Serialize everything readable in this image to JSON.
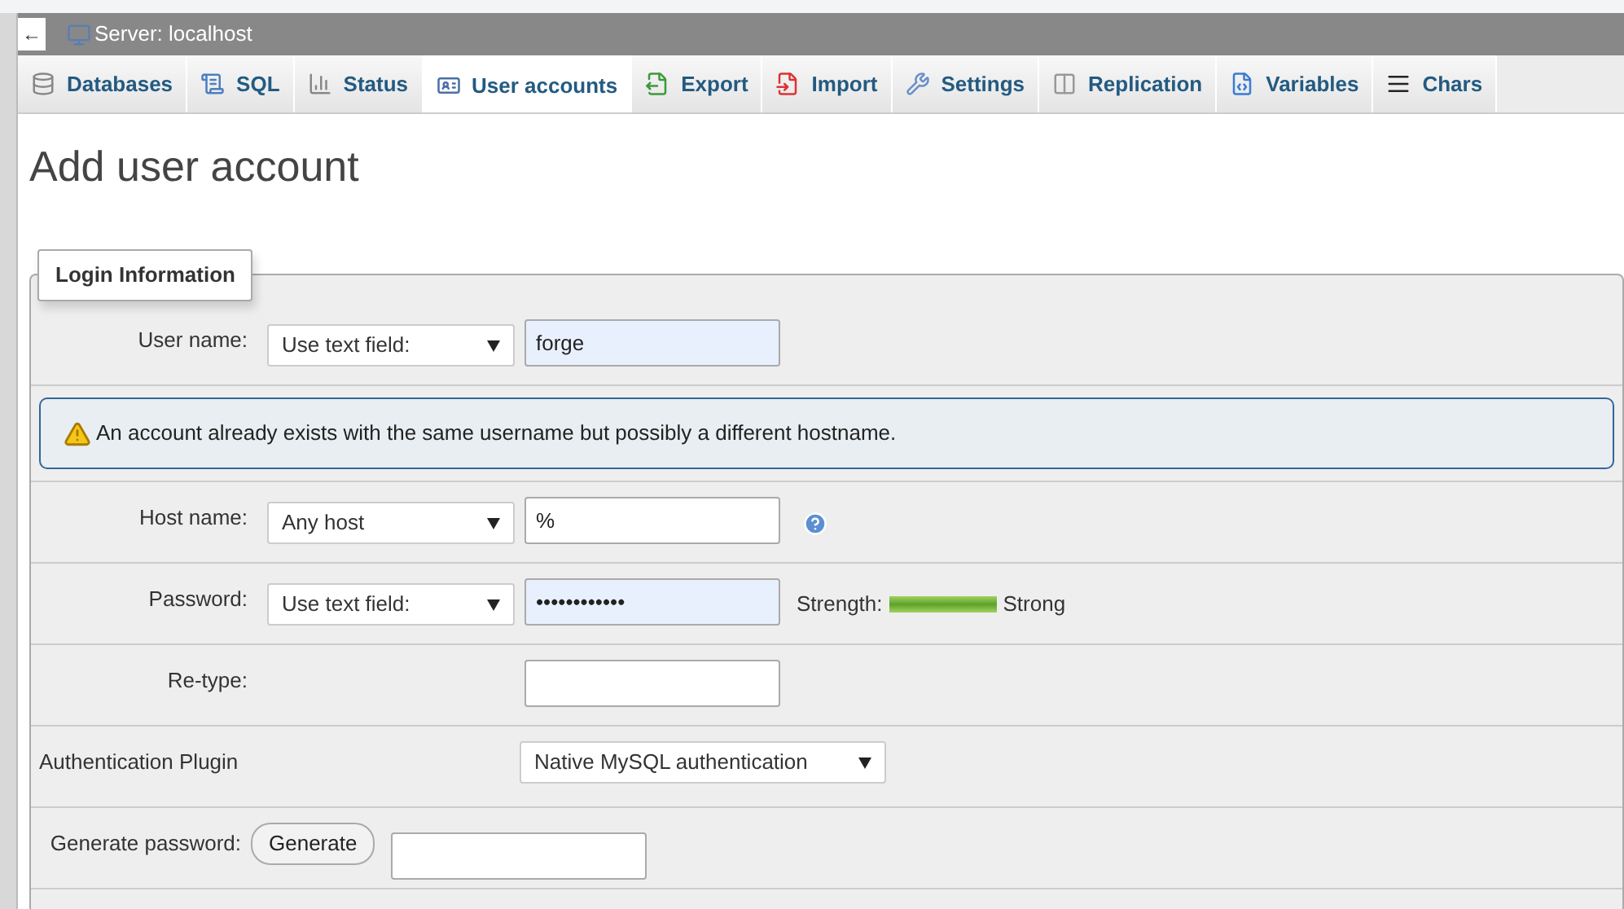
{
  "header": {
    "back": "←",
    "title": "Server: localhost"
  },
  "tabs": [
    {
      "label": "Databases",
      "selected": false
    },
    {
      "label": "SQL",
      "selected": false
    },
    {
      "label": "Status",
      "selected": false
    },
    {
      "label": "User accounts",
      "selected": true
    },
    {
      "label": "Export",
      "selected": false
    },
    {
      "label": "Import",
      "selected": false
    },
    {
      "label": "Settings",
      "selected": false
    },
    {
      "label": "Replication",
      "selected": false
    },
    {
      "label": "Variables",
      "selected": false
    },
    {
      "label": "Chars",
      "selected": false
    }
  ],
  "page_title": "Add user account",
  "fieldset": {
    "legend": "Login Information",
    "rows": [
      {
        "kind": "select-input",
        "label": "User name:",
        "select": "Use text field:",
        "value": "forge",
        "focused": true
      },
      {
        "kind": "notice",
        "text": "An account already exists with the same username but possibly a different hostname."
      },
      {
        "kind": "select-input",
        "label": "Host name:",
        "select": "Any host",
        "value": "%",
        "focused": false,
        "help": true
      },
      {
        "kind": "password",
        "label": "Password:",
        "select": "Use text field:",
        "value": "••••••••••••",
        "focused": true,
        "strength_label": "Strength:",
        "level": 1,
        "strength_text": "Strong"
      },
      {
        "kind": "input",
        "label": "Re-type:"
      },
      {
        "kind": "plugin",
        "label": "Authentication Plugin",
        "select": "Native MySQL authentication"
      },
      {
        "kind": "generate",
        "label": "Generate password:",
        "button": "Generate"
      }
    ]
  }
}
